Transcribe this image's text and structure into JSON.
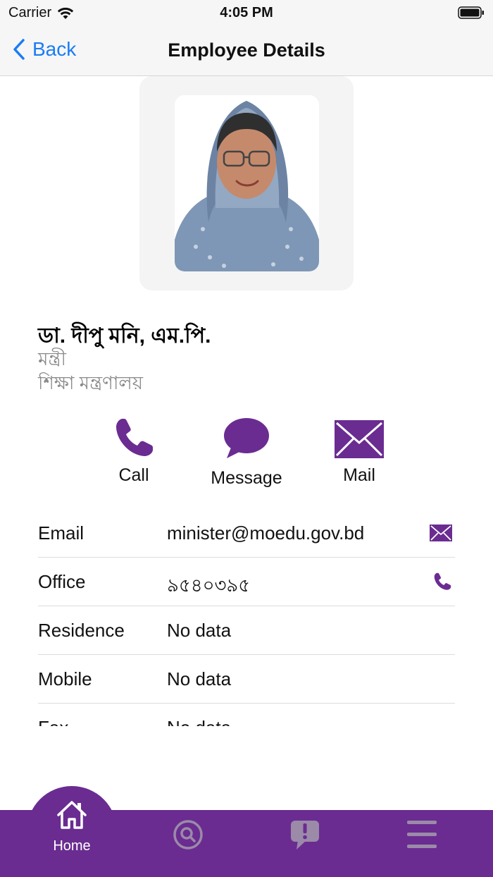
{
  "status_bar": {
    "carrier": "Carrier",
    "time": "4:05 PM"
  },
  "nav": {
    "back_label": "Back",
    "title": "Employee Details"
  },
  "profile": {
    "name": "ডা. দীপু মনি, এম.পি.",
    "designation": "মন্ত্রী",
    "ministry": "শিক্ষা মন্ত্রণালয়"
  },
  "actions": {
    "call": "Call",
    "message": "Message",
    "mail": "Mail"
  },
  "info": [
    {
      "label": "Email",
      "value": "minister@moedu.gov.bd",
      "icon": "mail-icon"
    },
    {
      "label": "Office",
      "value": "৯৫৪০৩৯৫",
      "icon": "phone-icon"
    },
    {
      "label": "Residence",
      "value": "No data"
    },
    {
      "label": "Mobile",
      "value": "No data"
    },
    {
      "label": "Fax",
      "value": "No data"
    }
  ],
  "tabs": {
    "home": "Home"
  },
  "colors": {
    "accent": "#6a2c91",
    "link": "#1a7cf5"
  }
}
